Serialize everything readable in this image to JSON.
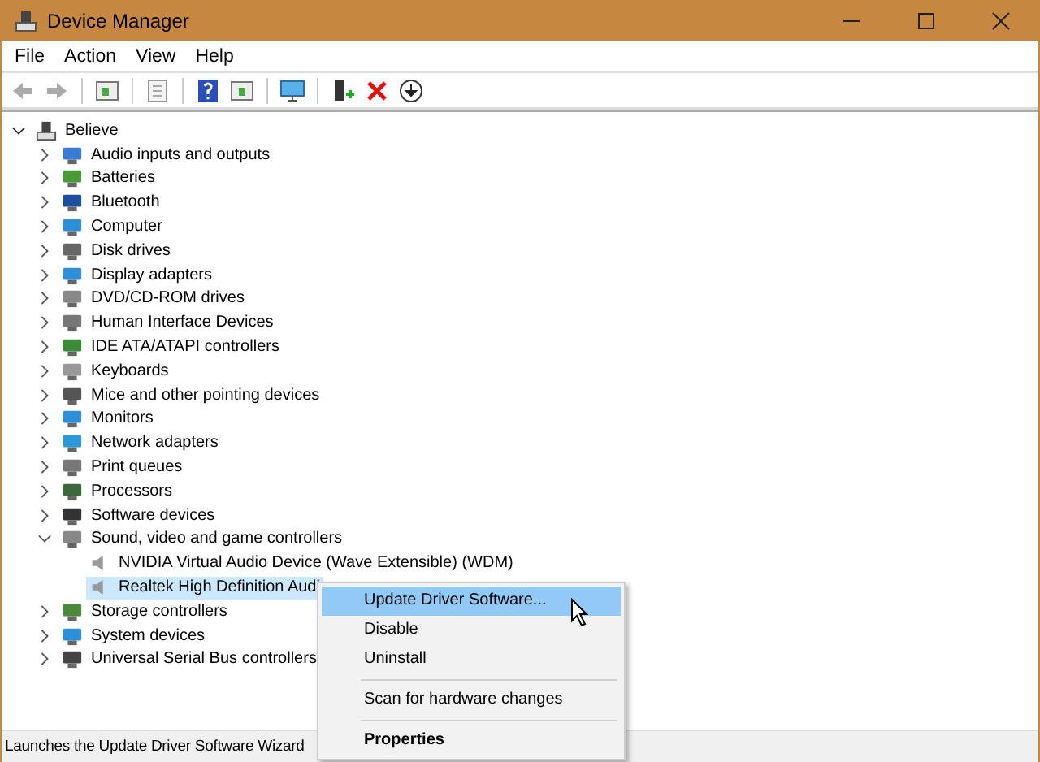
{
  "window": {
    "title": "Device Manager"
  },
  "menu_bar": [
    "File",
    "Action",
    "View",
    "Help"
  ],
  "tree": {
    "label": "Believe",
    "expanded": true,
    "selected": false,
    "children": [
      {
        "label": "Audio inputs and outputs",
        "expanded": false,
        "selected": false
      },
      {
        "label": "Batteries",
        "expanded": false,
        "selected": false
      },
      {
        "label": "Bluetooth",
        "expanded": false,
        "selected": false
      },
      {
        "label": "Computer",
        "expanded": false,
        "selected": false
      },
      {
        "label": "Disk drives",
        "expanded": false,
        "selected": false
      },
      {
        "label": "Display adapters",
        "expanded": false,
        "selected": false
      },
      {
        "label": "DVD/CD-ROM drives",
        "expanded": false,
        "selected": false
      },
      {
        "label": "Human Interface Devices",
        "expanded": false,
        "selected": false
      },
      {
        "label": "IDE ATA/ATAPI controllers",
        "expanded": false,
        "selected": false
      },
      {
        "label": "Keyboards",
        "expanded": false,
        "selected": false
      },
      {
        "label": "Mice and other pointing devices",
        "expanded": false,
        "selected": false
      },
      {
        "label": "Monitors",
        "expanded": false,
        "selected": false
      },
      {
        "label": "Network adapters",
        "expanded": false,
        "selected": false
      },
      {
        "label": "Print queues",
        "expanded": false,
        "selected": false
      },
      {
        "label": "Processors",
        "expanded": false,
        "selected": false
      },
      {
        "label": "Software devices",
        "expanded": false,
        "selected": false
      },
      {
        "label": "Sound, video and game controllers",
        "expanded": true,
        "selected": false,
        "children": [
          {
            "label": "NVIDIA Virtual Audio Device (Wave Extensible) (WDM)",
            "selected": false
          },
          {
            "label": "Realtek High Definition Audi",
            "selected": true
          }
        ]
      },
      {
        "label": "Storage controllers",
        "expanded": false,
        "selected": false
      },
      {
        "label": "System devices",
        "expanded": false,
        "selected": false
      },
      {
        "label": "Universal Serial Bus controllers",
        "expanded": false,
        "selected": false
      }
    ]
  },
  "context_menu": [
    [
      {
        "label": "Update Driver Software...",
        "selected": true,
        "bold": false
      },
      {
        "label": "Disable",
        "selected": false,
        "bold": false
      },
      {
        "label": "Uninstall",
        "selected": false,
        "bold": false
      }
    ],
    [
      {
        "label": "Scan for hardware changes",
        "selected": false,
        "bold": false
      }
    ],
    [
      {
        "label": "Properties",
        "selected": false,
        "bold": true
      }
    ]
  ],
  "status_bar": "Launches the Update Driver Software Wizard"
}
